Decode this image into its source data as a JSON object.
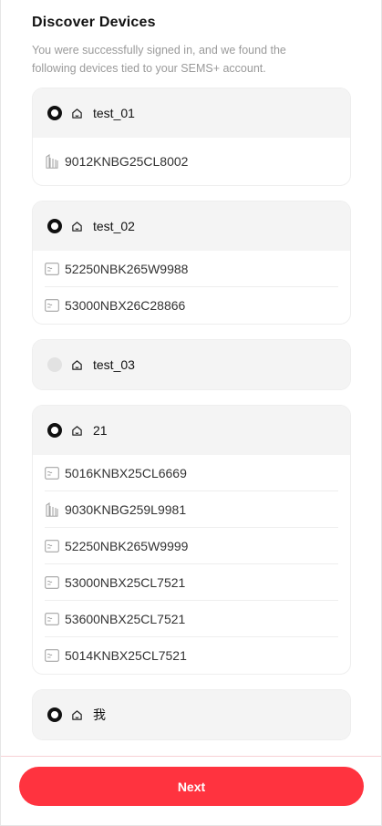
{
  "header": {
    "title": "Discover Devices",
    "subtitle": "You were successfully signed in, and we found the following devices tied to your SEMS+ account."
  },
  "groups": [
    {
      "name": "test_01",
      "selected": true,
      "icon": "home-icon",
      "devices": [
        {
          "sn": "9012KNBG25CL8002",
          "icon": "battery-icon"
        }
      ]
    },
    {
      "name": "test_02",
      "selected": true,
      "icon": "home-icon",
      "devices": [
        {
          "sn": "52250NBK265W9988",
          "icon": "inverter-icon"
        },
        {
          "sn": "53000NBX26C28866",
          "icon": "inverter-icon"
        }
      ]
    },
    {
      "name": "test_03",
      "selected": false,
      "icon": "home-icon",
      "devices": []
    },
    {
      "name": "21",
      "selected": true,
      "icon": "home-icon",
      "devices": [
        {
          "sn": "5016KNBX25CL6669",
          "icon": "inverter-icon"
        },
        {
          "sn": "9030KNBG259L9981",
          "icon": "battery-icon"
        },
        {
          "sn": "52250NBK265W9999",
          "icon": "inverter-icon"
        },
        {
          "sn": "53000NBX25CL7521",
          "icon": "inverter-icon"
        },
        {
          "sn": "53600NBX25CL7521",
          "icon": "inverter-icon"
        },
        {
          "sn": "5014KNBX25CL7521",
          "icon": "inverter-icon"
        }
      ]
    },
    {
      "name": "我",
      "selected": true,
      "icon": "home-icon",
      "devices": []
    }
  ],
  "footer": {
    "next_label": "Next"
  },
  "colors": {
    "accent": "#ff333f",
    "selected_radio": "#111111",
    "unselected_radio": "#e2e2e2"
  }
}
